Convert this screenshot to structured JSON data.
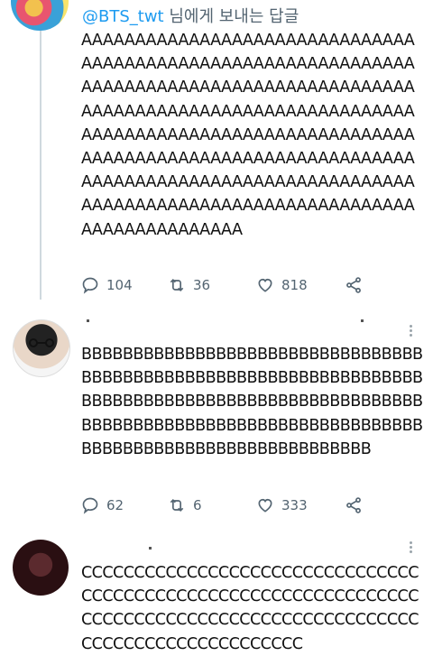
{
  "tweet1": {
    "reply_handle": "@BTS_twt",
    "reply_suffix": "님에게 보내는 답글",
    "text": "AAAAAAAAAAAAAAAAAAAAAAAAAAAAAAAAAAAAAAAAAAAAAAAAAAAAAAAAAAAAAAAAAAAAAAAAAAAAAAAAAAAAAAAAAAAAAAAAAAAAAAAAAAAAAAAAAAAAAAAAAAAAAAAAAAAAAAAAAAAAAAAAAAAAAAAAAAAAAAAAAAAAAAAAAAAAAAAAAAAAAAAAAAAAAAAAAAAAAAAAAAAAAAAAAAAAAAAAAAAAAAAAAAAAAAAAAAAAAAAAAAAAAAAAAAAAAAAAAAAAAAA",
    "replies": "104",
    "retweets": "36",
    "likes": "818"
  },
  "tweet2": {
    "text": "BBBBBBBBBBBBBBBBBBBBBBBBBBBBBBBBBBBBBBBBBBBBBBBBBBBBBBBBBBBBBBBBBBBBBBBBBBBBBBBBBBBBBBBBBBBBBBBBBBBBBBBBBBBBBBBBBBBBBBBBBBBBBBBBBBBBBBBBBBBBBBBBBBBBBBBBBBBBBBBB",
    "replies": "62",
    "retweets": "6",
    "likes": "333"
  },
  "tweet3": {
    "text": "CCCCCCCCCCCCCCCCCCCCCCCCCCCCCCCCCCCCCCCCCCCCCCCCCCCCCCCCCCCCCCCCCCCCCCCCCCCCCCCCCCCCCCCCCCCCCCCCCCCCCCCCCCCCCCCCCCCCC"
  }
}
